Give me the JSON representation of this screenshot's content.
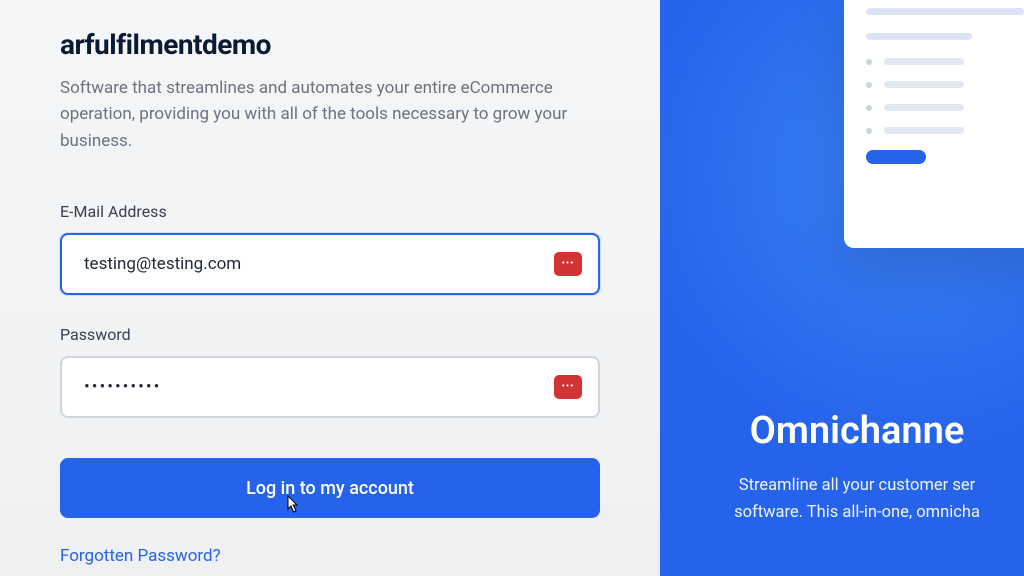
{
  "brand": {
    "title": "arfulfilmentdemo",
    "subtitle": "Software that streamlines and automates your entire eCommerce operation, providing you with all of the tools necessary to grow your business."
  },
  "form": {
    "email_label": "E-Mail Address",
    "email_value": "testing@testing.com",
    "password_label": "Password",
    "password_value": "••••••••••",
    "login_button": "Log in to my account",
    "forgot_link": "Forgotten Password?"
  },
  "hero": {
    "title": "Omnichanne",
    "line1": "Streamline all your customer ser",
    "line2": "software. This all-in-one, omnicha"
  }
}
